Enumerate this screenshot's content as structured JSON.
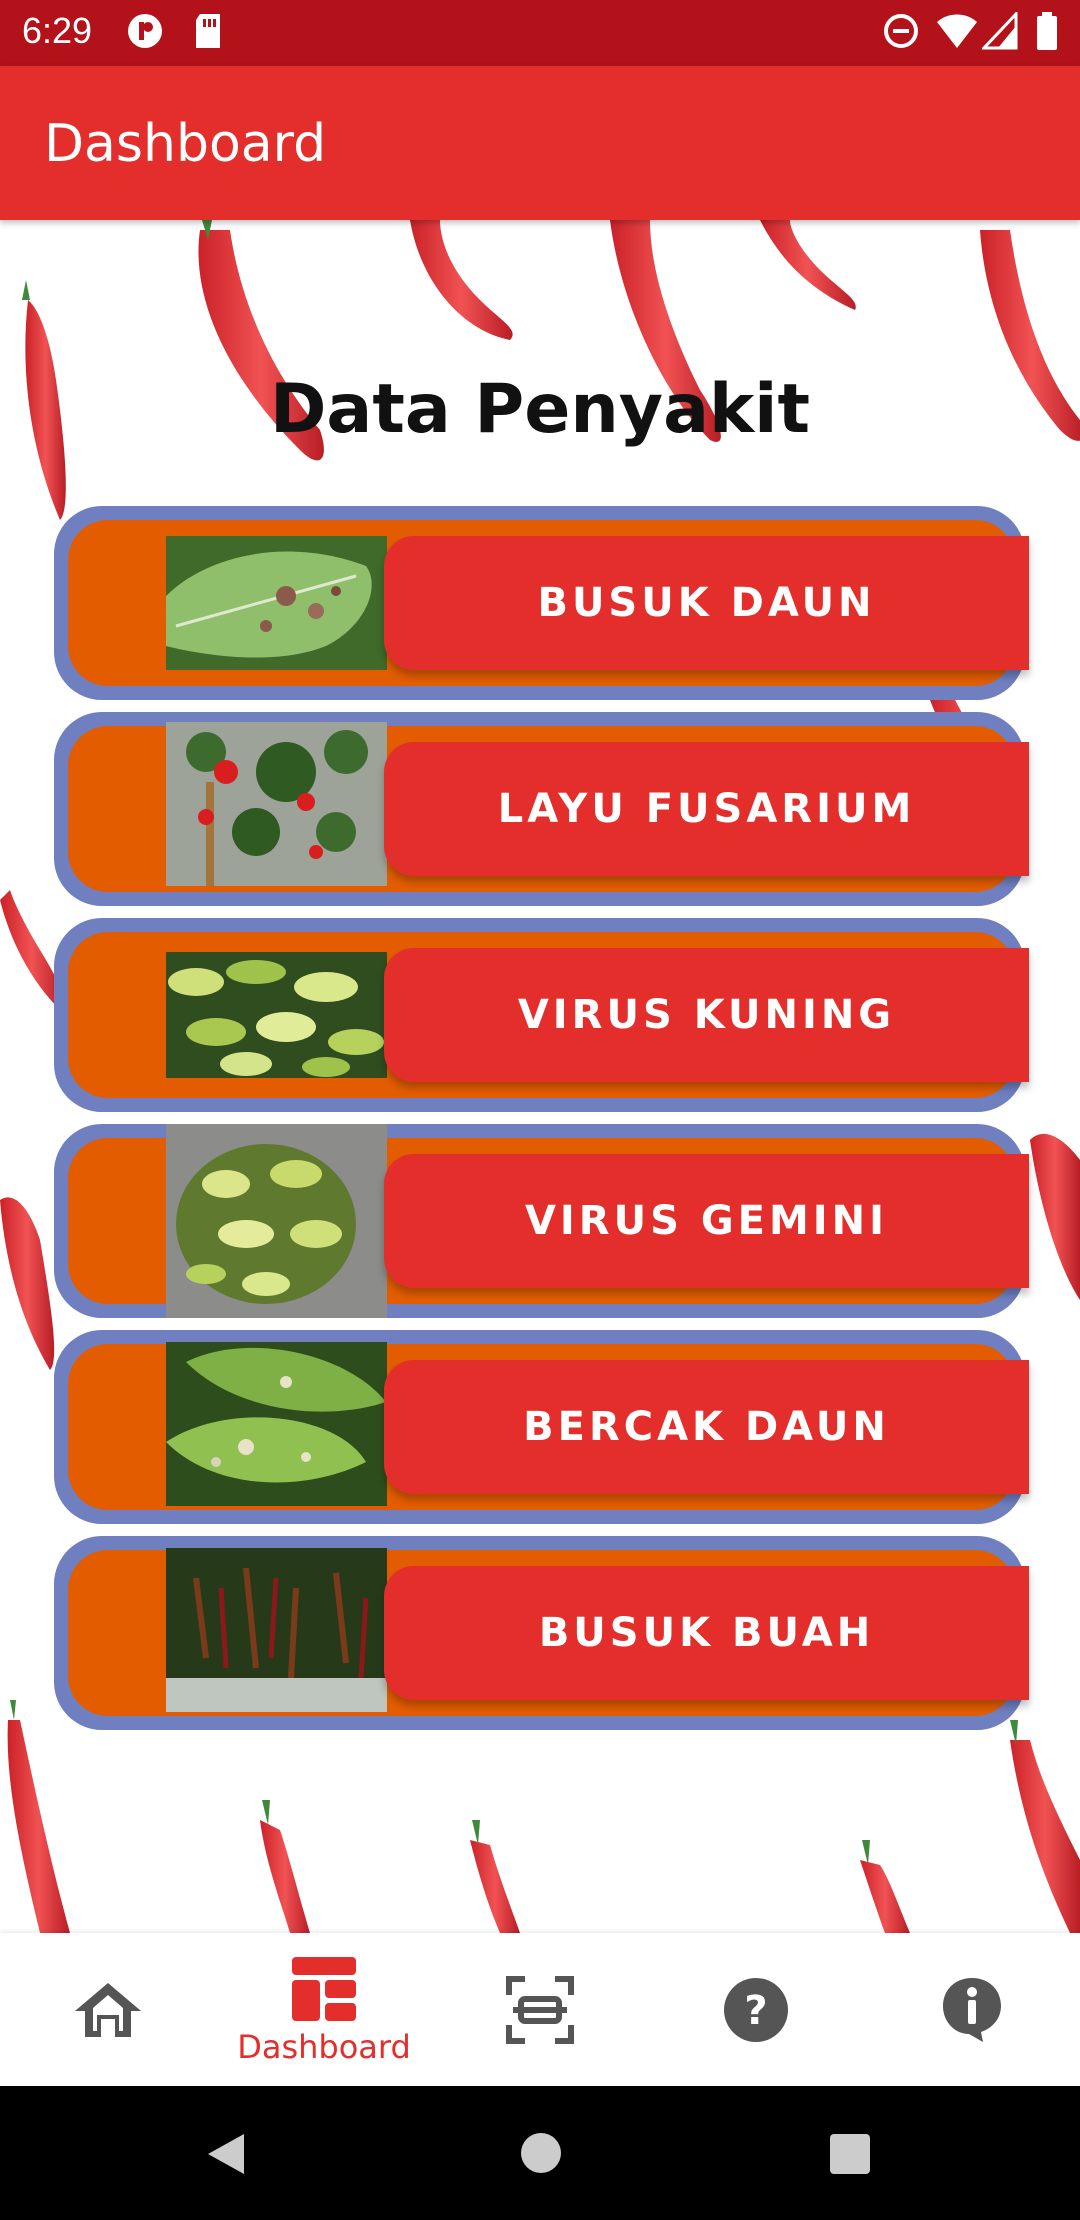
{
  "status_bar": {
    "time": "6:29"
  },
  "app_bar": {
    "title": "Dashboard"
  },
  "main": {
    "heading": "Data Penyakit",
    "diseases": [
      {
        "label": "BUSUK DAUN"
      },
      {
        "label": "LAYU FUSARIUM"
      },
      {
        "label": "VIRUS KUNING"
      },
      {
        "label": "VIRUS GEMINI"
      },
      {
        "label": "BERCAK DAUN"
      },
      {
        "label": "BUSUK BUAH"
      }
    ]
  },
  "bottom_nav": {
    "items": [
      {
        "icon": "home-icon",
        "label": ""
      },
      {
        "icon": "dashboard-icon",
        "label": "Dashboard",
        "active": true
      },
      {
        "icon": "scan-icon",
        "label": ""
      },
      {
        "icon": "help-icon",
        "label": ""
      },
      {
        "icon": "info-icon",
        "label": ""
      }
    ]
  },
  "colors": {
    "primary": "#e32e2b",
    "status_bar": "#b3121a",
    "card_border": "#6f7fbf",
    "card_fill": "#e35d00"
  }
}
